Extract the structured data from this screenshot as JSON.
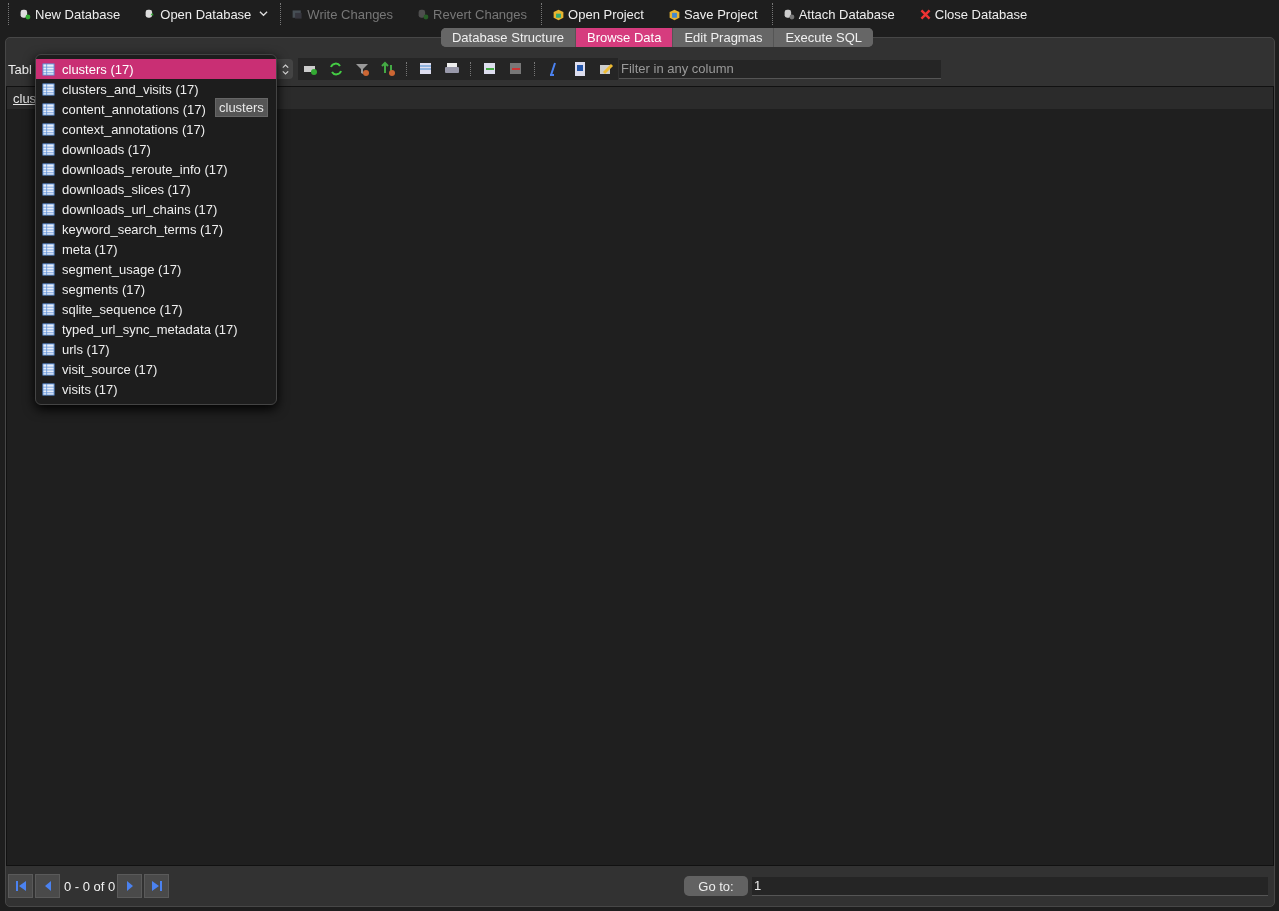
{
  "toolbar": {
    "groups": [
      [
        {
          "label": "New Database",
          "disabled": false,
          "menu": false
        },
        {
          "label": "Open Database",
          "disabled": false,
          "menu": true
        }
      ],
      [
        {
          "label": "Write Changes",
          "disabled": true,
          "menu": false
        },
        {
          "label": "Revert Changes",
          "disabled": true,
          "menu": false
        }
      ],
      [
        {
          "label": "Open Project",
          "disabled": false,
          "menu": false
        },
        {
          "label": "Save Project",
          "disabled": false,
          "menu": false
        }
      ],
      [
        {
          "label": "Attach Database",
          "disabled": false,
          "menu": false
        },
        {
          "label": "Close Database",
          "disabled": false,
          "menu": false
        }
      ]
    ]
  },
  "tabs": [
    {
      "label": "Database Structure",
      "selected": false
    },
    {
      "label": "Browse Data",
      "selected": true
    },
    {
      "label": "Edit Pragmas",
      "selected": false
    },
    {
      "label": "Execute SQL",
      "selected": false
    }
  ],
  "browse": {
    "table_label": "Tabl",
    "filter": {
      "placeholder": "Filter in any column"
    },
    "column_header": "clus",
    "table_menu": {
      "items": [
        {
          "label": "clusters (17)",
          "selected": true
        },
        {
          "label": "clusters_and_visits (17)",
          "selected": false
        },
        {
          "label": "content_annotations (17)",
          "selected": false
        },
        {
          "label": "context_annotations (17)",
          "selected": false
        },
        {
          "label": "downloads (17)",
          "selected": false
        },
        {
          "label": "downloads_reroute_info (17)",
          "selected": false
        },
        {
          "label": "downloads_slices (17)",
          "selected": false
        },
        {
          "label": "downloads_url_chains (17)",
          "selected": false
        },
        {
          "label": "keyword_search_terms (17)",
          "selected": false
        },
        {
          "label": "meta (17)",
          "selected": false
        },
        {
          "label": "segment_usage (17)",
          "selected": false
        },
        {
          "label": "segments (17)",
          "selected": false
        },
        {
          "label": "sqlite_sequence (17)",
          "selected": false
        },
        {
          "label": "typed_url_sync_metadata (17)",
          "selected": false
        },
        {
          "label": "urls (17)",
          "selected": false
        },
        {
          "label": "visit_source (17)",
          "selected": false
        },
        {
          "label": "visits (17)",
          "selected": false
        }
      ],
      "tooltip": "clusters"
    },
    "record_range": "0 - 0 of 0",
    "goto": {
      "label": "Go to:",
      "value": "1"
    }
  }
}
